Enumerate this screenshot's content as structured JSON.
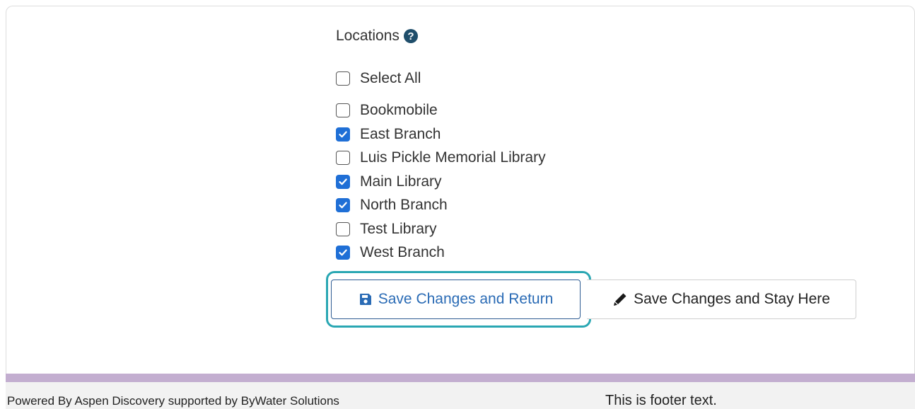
{
  "locations": {
    "label": "Locations",
    "help_icon": "question-circle-icon",
    "select_all": {
      "label": "Select All",
      "checked": false
    },
    "items": [
      {
        "label": "Bookmobile",
        "checked": false
      },
      {
        "label": "East Branch",
        "checked": true
      },
      {
        "label": "Luis Pickle Memorial Library",
        "checked": false
      },
      {
        "label": "Main Library",
        "checked": true
      },
      {
        "label": "North Branch",
        "checked": true
      },
      {
        "label": "Test Library",
        "checked": false
      },
      {
        "label": "West Branch",
        "checked": true
      }
    ]
  },
  "buttons": {
    "save_return": {
      "label": "Save Changes and Return",
      "icon": "floppy-disk-icon"
    },
    "save_stay": {
      "label": "Save Changes and Stay Here",
      "icon": "pencil-icon"
    }
  },
  "footer": {
    "powered_by": "Powered By Aspen Discovery supported by ByWater Solutions",
    "footer_text": "This is footer text."
  },
  "colors": {
    "accent": "#1f6fd6",
    "focus_ring": "#2aa7b3",
    "footer_stripe": "#c3aed0",
    "help_icon": "#1f4e6b"
  }
}
